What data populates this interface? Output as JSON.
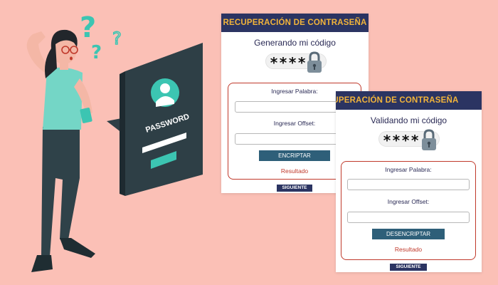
{
  "card1": {
    "header": "RECUPERACIÓN DE CONTRASEÑA",
    "subtitle": "Generando mi código",
    "code": "****",
    "word_label": "Ingresar Palabra:",
    "offset_label": "Ingresar Offset:",
    "action_button": "ENCRIPTAR",
    "result_label": "Resultado",
    "next_button": "SIGUIENTE"
  },
  "card2": {
    "header": "RECUPERACIÓN DE CONTRASEÑA",
    "subtitle": "Validando mi código",
    "code": "****",
    "word_label": "Ingresar Palabra:",
    "offset_label": "Ingresar Offset:",
    "action_button": "DESENCRIPTAR",
    "result_label": "Resultado",
    "next_button": "SIGUIENTE"
  },
  "illustration": {
    "card_text": "PASSWORD",
    "icons": [
      "question-mark-icon",
      "user-avatar-icon",
      "lock-icon"
    ]
  },
  "colors": {
    "background": "#fbc0b6",
    "header_bg": "#2b3462",
    "header_text": "#f2b43a",
    "button_bg": "#2e5f79",
    "accent_red": "#c0392b",
    "teal": "#3cc5b2"
  }
}
